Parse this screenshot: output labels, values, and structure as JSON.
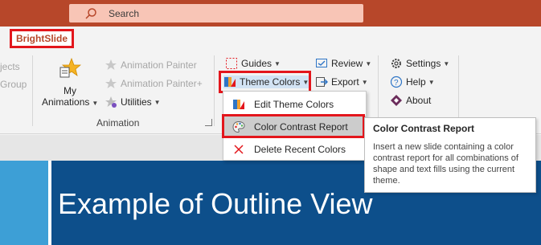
{
  "titlebar": {
    "search_placeholder": "Search",
    "bg_color": "#b7472a"
  },
  "tabs": {
    "active": "BrightSlide"
  },
  "ribbon": {
    "left_ghost": [
      "jects",
      "Group"
    ],
    "animation_group": {
      "my_animations_l1": "My",
      "my_animations_l2": "Animations",
      "animation_painter": "Animation Painter",
      "animation_painter_plus": "Animation Painter+",
      "utilities": "Utilities",
      "group_label": "Animation"
    },
    "guides": "Guides",
    "theme_colors": "Theme Colors",
    "review": "Review",
    "export": "Export",
    "settings": "Settings",
    "help": "Help",
    "about": "About"
  },
  "menu": {
    "items": [
      {
        "label": "Edit Theme Colors",
        "icon": "edit-theme-colors-icon"
      },
      {
        "label": "Color Contrast Report",
        "icon": "palette-icon"
      },
      {
        "label": "Delete Recent Colors",
        "icon": "delete-x-icon"
      }
    ]
  },
  "tooltip": {
    "title": "Color Contrast Report",
    "body": "Insert a new slide containing a color contrast report for all combinations of shape and text fills using the current theme."
  },
  "slide": {
    "title": "Example of Outline View"
  },
  "colors": {
    "accent_red": "#e3161c",
    "slide_bg": "#0d4f8b",
    "strip": "#3d9fd6"
  }
}
